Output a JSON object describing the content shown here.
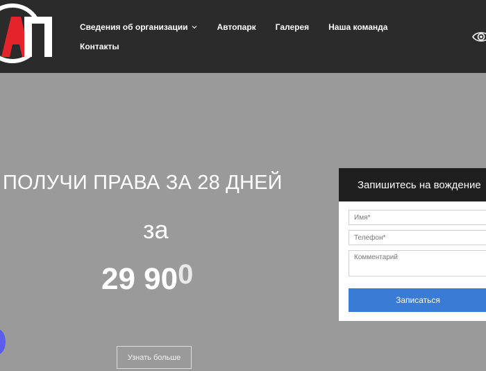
{
  "header": {
    "logo_text": "АП",
    "nav_row1": [
      {
        "label": "Сведения об организации",
        "has_dropdown": true
      },
      {
        "label": "Автопарк"
      },
      {
        "label": "Галерея"
      },
      {
        "label": "Наша команда"
      }
    ],
    "nav_row2": [
      {
        "label": "Контакты"
      }
    ],
    "accessibility_icon": "eye-icon"
  },
  "hero": {
    "headline": "ПОЛУЧИ ПРАВА ЗА 28 ДНЕЙ",
    "za": "за",
    "price_main": "29 90",
    "price_tail": "0",
    "more_button": "Узнать больше"
  },
  "form": {
    "title": "Запишитесь на вождение",
    "name_placeholder": "Имя*",
    "phone_placeholder": "Телефон*",
    "comment_placeholder": "Комментарий",
    "submit_label": "Записаться"
  },
  "colors": {
    "header_bg": "#2b2b2b",
    "hero_bg": "#9a9a9a",
    "logo_red": "#e5232b",
    "button_blue": "#3a7bd5",
    "chat_purple": "#5c5cf0"
  }
}
